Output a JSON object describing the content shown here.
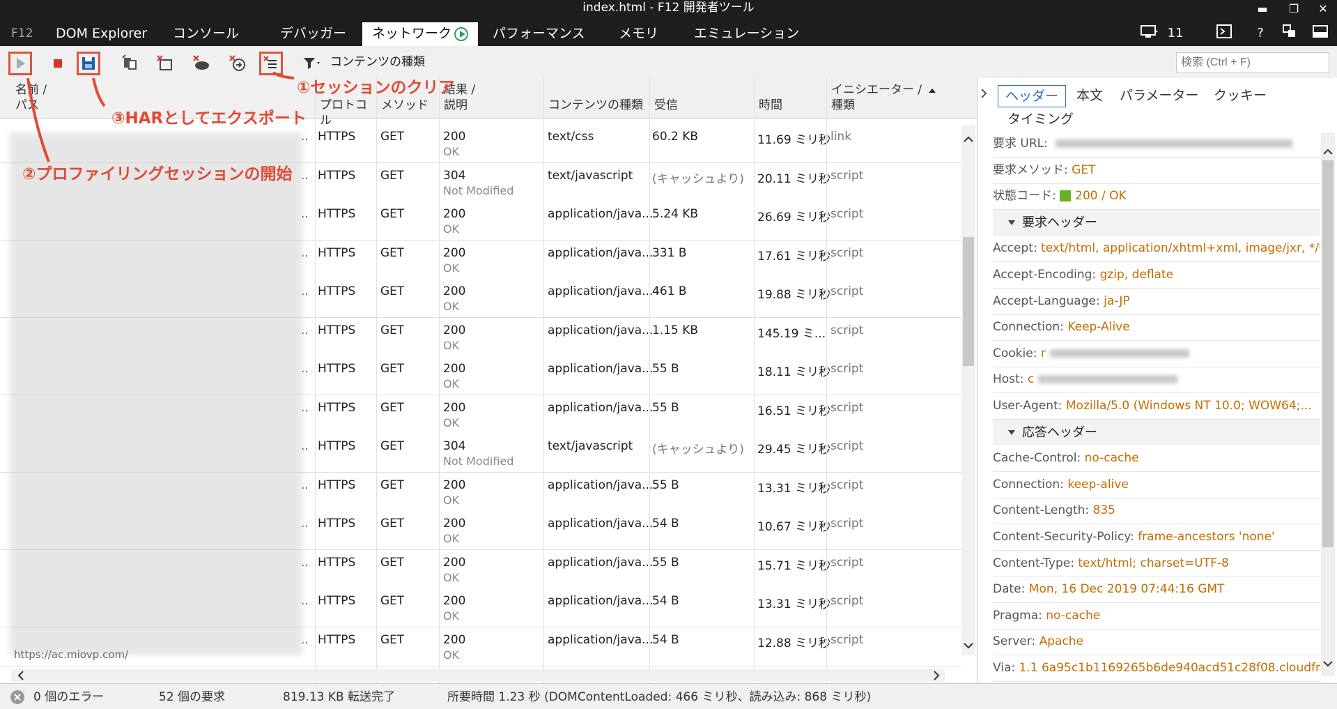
{
  "window": {
    "title": "index.html - F12 開発者ツール",
    "controls": [
      "▬",
      "❐",
      "✕"
    ]
  },
  "tabs": [
    {
      "label": "F12"
    },
    {
      "label": "DOM Explorer"
    },
    {
      "label": "コンソール"
    },
    {
      "label": "デバッガー"
    },
    {
      "label": "ネットワーク"
    },
    {
      "label": "パフォーマンス"
    },
    {
      "label": "メモリ"
    },
    {
      "label": "エミュレーション"
    }
  ],
  "topright": {
    "emulation_count": "11",
    "help": "?"
  },
  "toolbar": {
    "filter_label": "コンテンツの種類",
    "search_placeholder": "検索 (Ctrl + F)"
  },
  "columns": {
    "name": "名前 /\nパス",
    "protocol": "プロトコル",
    "method": "メソッド",
    "result": "結果 /\n説明",
    "content_type": "コンテンツの種類",
    "received": "受信",
    "time": "時間",
    "initiator": "イニシエーター /\n種類"
  },
  "rows": [
    {
      "protocol": "HTTPS",
      "method": "GET",
      "status": "200",
      "desc": "OK",
      "type": "text/css",
      "received": "60.2 KB",
      "time": "11.69 ミリ秒",
      "initiator": "link"
    },
    {
      "protocol": "HTTPS",
      "method": "GET",
      "status": "304",
      "desc": "Not Modified",
      "type": "text/javascript",
      "received": "(キャッシュより)",
      "time": "20.11 ミリ秒",
      "initiator": "script"
    },
    {
      "protocol": "HTTPS",
      "method": "GET",
      "status": "200",
      "desc": "OK",
      "type": "application/java...",
      "received": "5.24 KB",
      "time": "26.69 ミリ秒",
      "initiator": "script"
    },
    {
      "protocol": "HTTPS",
      "method": "GET",
      "status": "200",
      "desc": "OK",
      "type": "application/java...",
      "received": "331 B",
      "time": "17.61 ミリ秒",
      "initiator": "script"
    },
    {
      "protocol": "HTTPS",
      "method": "GET",
      "status": "200",
      "desc": "OK",
      "type": "application/java...",
      "received": "461 B",
      "time": "19.88 ミリ秒",
      "initiator": "script"
    },
    {
      "protocol": "HTTPS",
      "method": "GET",
      "status": "200",
      "desc": "OK",
      "type": "application/java...",
      "received": "1.15 KB",
      "time": "145.19 ミ...",
      "initiator": "script"
    },
    {
      "protocol": "HTTPS",
      "method": "GET",
      "status": "200",
      "desc": "OK",
      "type": "application/java...",
      "received": "55 B",
      "time": "18.11 ミリ秒",
      "initiator": "script"
    },
    {
      "protocol": "HTTPS",
      "method": "GET",
      "status": "200",
      "desc": "OK",
      "type": "application/java...",
      "received": "55 B",
      "time": "16.51 ミリ秒",
      "initiator": "script"
    },
    {
      "protocol": "HTTPS",
      "method": "GET",
      "status": "304",
      "desc": "Not Modified",
      "type": "text/javascript",
      "received": "(キャッシュより)",
      "time": "29.45 ミリ秒",
      "initiator": "script"
    },
    {
      "protocol": "HTTPS",
      "method": "GET",
      "status": "200",
      "desc": "OK",
      "type": "application/java...",
      "received": "55 B",
      "time": "13.31 ミリ秒",
      "initiator": "script"
    },
    {
      "protocol": "HTTPS",
      "method": "GET",
      "status": "200",
      "desc": "OK",
      "type": "application/java...",
      "received": "54 B",
      "time": "10.67 ミリ秒",
      "initiator": "script"
    },
    {
      "protocol": "HTTPS",
      "method": "GET",
      "status": "200",
      "desc": "OK",
      "type": "application/java...",
      "received": "55 B",
      "time": "15.71 ミリ秒",
      "initiator": "script"
    },
    {
      "protocol": "HTTPS",
      "method": "GET",
      "status": "200",
      "desc": "OK",
      "type": "application/java...",
      "received": "54 B",
      "time": "13.31 ミリ秒",
      "initiator": "script"
    },
    {
      "protocol": "HTTPS",
      "method": "GET",
      "status": "200",
      "desc": "OK",
      "type": "application/java...",
      "received": "54 B",
      "time": "12.88 ミリ秒",
      "initiator": "script"
    }
  ],
  "bottom_url": "https://ac.miovp.com/",
  "right_tabs": [
    "ヘッダー",
    "本文",
    "パラメーター",
    "クッキー",
    "タイミング"
  ],
  "general": [
    {
      "k": "要求 URL:",
      "v": ""
    },
    {
      "k": "要求メソッド:",
      "v": "GET"
    },
    {
      "k": "状態コード:",
      "v": "200 / OK"
    }
  ],
  "request_headers_title": "要求ヘッダー",
  "request_headers": [
    {
      "k": "Accept:",
      "v": "text/html, application/xhtml+xml, image/jxr, */*"
    },
    {
      "k": "Accept-Encoding:",
      "v": "gzip, deflate"
    },
    {
      "k": "Accept-Language:",
      "v": "ja-JP"
    },
    {
      "k": "Connection:",
      "v": "Keep-Alive"
    },
    {
      "k": "Cookie:",
      "v": "r"
    },
    {
      "k": "Host:",
      "v": "c"
    },
    {
      "k": "User-Agent:",
      "v": "Mozilla/5.0 (Windows NT 10.0; WOW64;..."
    }
  ],
  "response_headers_title": "応答ヘッダー",
  "response_headers": [
    {
      "k": "Cache-Control:",
      "v": "no-cache"
    },
    {
      "k": "Connection:",
      "v": "keep-alive"
    },
    {
      "k": "Content-Length:",
      "v": "835"
    },
    {
      "k": "Content-Security-Policy:",
      "v": "frame-ancestors 'none'"
    },
    {
      "k": "Content-Type:",
      "v": "text/html; charset=UTF-8"
    },
    {
      "k": "Date:",
      "v": "Mon, 16 Dec 2019 07:44:16 GMT"
    },
    {
      "k": "Pragma:",
      "v": "no-cache"
    },
    {
      "k": "Server:",
      "v": "Apache"
    },
    {
      "k": "Via:",
      "v": "1.1 6a95c1b1169265b6de940acd51c28f08.cloudfr..."
    }
  ],
  "status": {
    "errors": "0 個のエラー",
    "requests": "52 個の要求",
    "transferred": "819.13 KB 転送完了",
    "timing": "所要時間 1.23 秒 (DOMContentLoaded: 466 ミリ秒、読み込み: 868 ミリ秒)"
  },
  "annotations": {
    "clear": "①セッションのクリア",
    "start": "②プロファイリングセッションの開始",
    "export": "③HARとしてエクスポート"
  },
  "colors": {
    "accent": "#2a6ccf",
    "annotation": "#e04a33",
    "value": "#c26e00",
    "status_ok": "#6ab023"
  }
}
